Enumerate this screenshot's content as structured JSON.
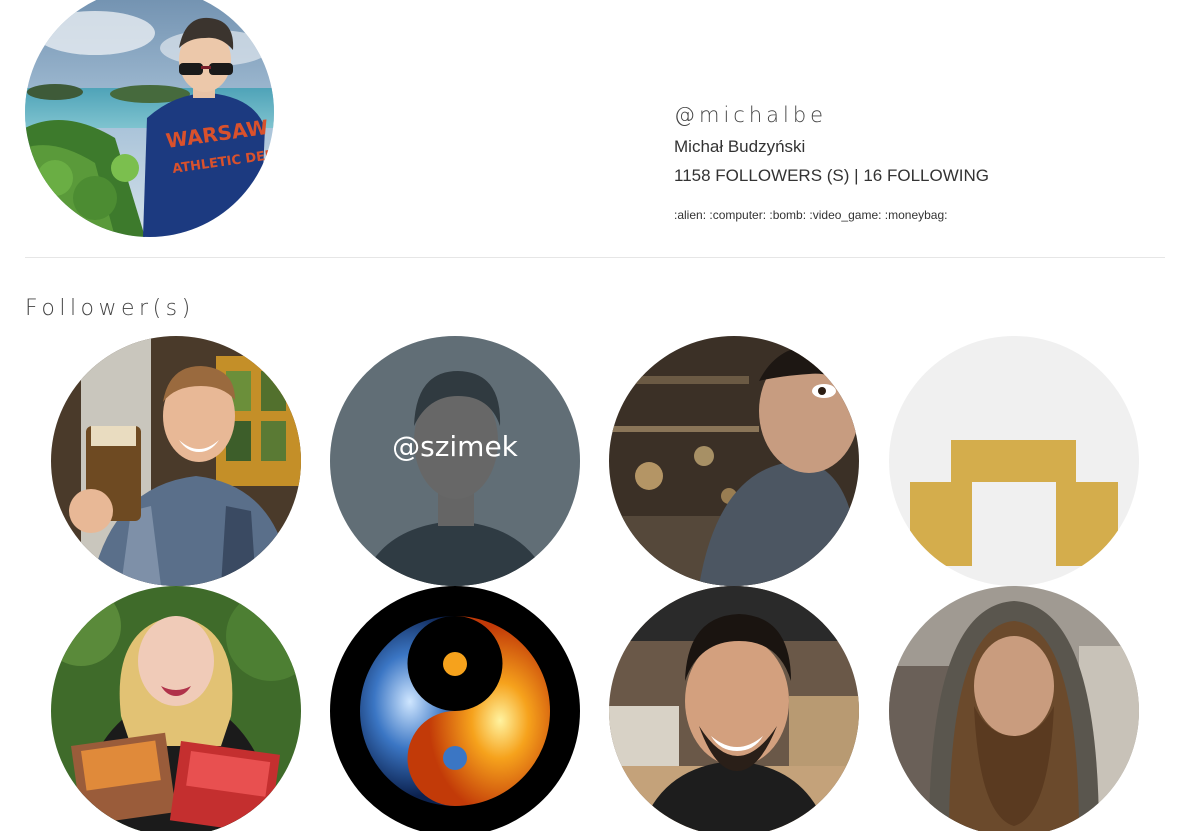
{
  "profile": {
    "handle": "@michalbe",
    "full_name": "Michał Budzyński",
    "followers_count": "1158",
    "followers_label": "FOLLOWERS (S)",
    "separator": "|",
    "following_count": "16",
    "following_label": "FOLLOWING",
    "bio": ":alien: :computer: :bomb: :video_game: :moneybag:"
  },
  "followers_section": {
    "title": "Follower(s)",
    "hovered_handle": "@szimek",
    "items": [
      {
        "icon": "avatar-man-with-beer"
      },
      {
        "icon": "avatar-man-dark-shirt"
      },
      {
        "icon": "avatar-man-in-cafe"
      },
      {
        "icon": "avatar-identicon-gold"
      },
      {
        "icon": "avatar-woman-with-books"
      },
      {
        "icon": "avatar-fire-water-yin-yang"
      },
      {
        "icon": "avatar-smiling-man-bakery"
      },
      {
        "icon": "avatar-bearded-man-hood"
      }
    ]
  },
  "colors": {
    "identicon": "#d4ad4c",
    "identicon_bg": "#f0f0f0",
    "hover_overlay": "#374650"
  }
}
